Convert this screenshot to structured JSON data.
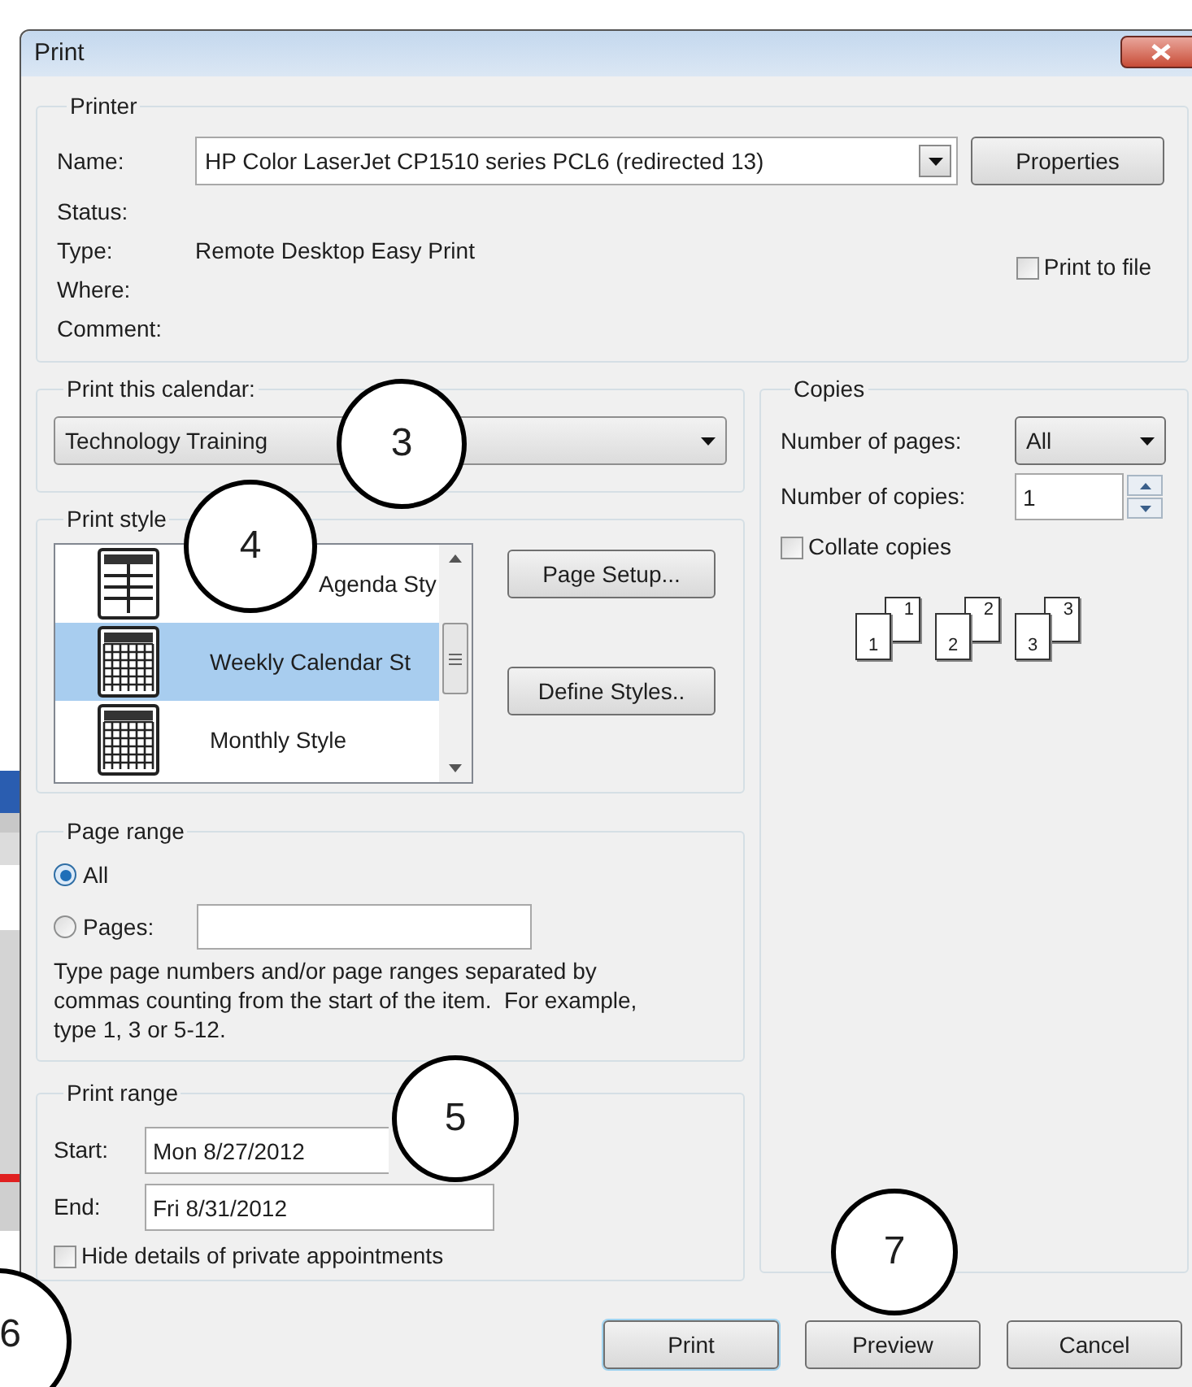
{
  "window": {
    "title": "Print"
  },
  "printer": {
    "title": "Printer",
    "name_label": "Name:",
    "name_value": "HP Color LaserJet CP1510 series PCL6 (redirected 13)",
    "properties_button": "Properties",
    "details": [
      {
        "label": "Status:"
      },
      {
        "label": "Type:",
        "value": "Remote Desktop Easy Print"
      },
      {
        "label": "Where:"
      },
      {
        "label": "Comment:"
      }
    ],
    "print_to_file": {
      "label": "Print to file",
      "checked": false
    }
  },
  "calendar": {
    "title": "Print this calendar:",
    "value": "Technology Training"
  },
  "print_style": {
    "title": "Print style",
    "items": [
      {
        "label": "Agenda Sty",
        "kind": "agenda",
        "selected": false
      },
      {
        "label": "Weekly Calendar St",
        "kind": "calendar",
        "selected": true
      },
      {
        "label": "Monthly Style",
        "kind": "calendar",
        "selected": false
      }
    ],
    "buttons": [
      "Page Setup...",
      "Define Styles.."
    ]
  },
  "page_range": {
    "title": "Page range",
    "options": [
      {
        "label": "All",
        "selected": true
      },
      {
        "label": "Pages:",
        "selected": false
      }
    ],
    "hint": "Type page numbers and/or page ranges separated by commas counting from the start of the item.  For example, type 1, 3 or 5-12."
  },
  "print_range": {
    "title": "Print range",
    "start_label": "Start:",
    "start_value": "Mon 8/27/2012",
    "end_label": "End:",
    "end_value": "Fri 8/31/2012",
    "hide_private": {
      "label": "Hide details of private appointments",
      "checked": false
    }
  },
  "copies": {
    "title": "Copies",
    "pages_label": "Number of pages:",
    "pages_value": "All",
    "copies_label": "Number of copies:",
    "copies_value": "1",
    "collate": {
      "label": "Collate copies",
      "checked": false
    },
    "collate_pages": [
      {
        "front": "1",
        "back": "1"
      },
      {
        "front": "2",
        "back": "2"
      },
      {
        "front": "3",
        "back": "3"
      }
    ]
  },
  "buttons": [
    {
      "label": "Print",
      "default": true
    },
    {
      "label": "Preview",
      "default": false
    },
    {
      "label": "Cancel",
      "default": false
    }
  ],
  "annotations": [
    {
      "label": "3"
    },
    {
      "label": "4"
    },
    {
      "label": "5"
    },
    {
      "label": "6"
    },
    {
      "label": "7"
    }
  ]
}
